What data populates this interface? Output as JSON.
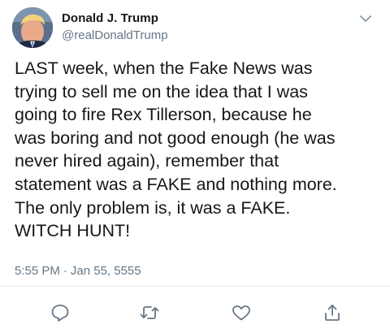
{
  "author": {
    "name": "Donald J. Trump",
    "handle": "@realDonaldTrump"
  },
  "tweet": {
    "lines": [
      "LAST week, when the Fake News was",
      "trying to sell me on the idea that I was",
      "going to fire Rex Tillerson, because he",
      "was boring and not good enough (he was",
      "never hired again), remember that",
      "statement was a FAKE and nothing more.",
      "The only problem is, it was a FAKE.",
      "WITCH HUNT!"
    ],
    "time": "5:55 PM",
    "separator": "·",
    "date": "Jan 55, 5555"
  },
  "icons": {
    "caret": "chevron-down-icon",
    "reply": "reply-icon",
    "retweet": "retweet-icon",
    "like": "heart-icon",
    "share": "share-icon"
  },
  "colors": {
    "text": "#14171a",
    "secondary": "#657786",
    "icon": "#657786",
    "divider": "#e6ecf0"
  }
}
